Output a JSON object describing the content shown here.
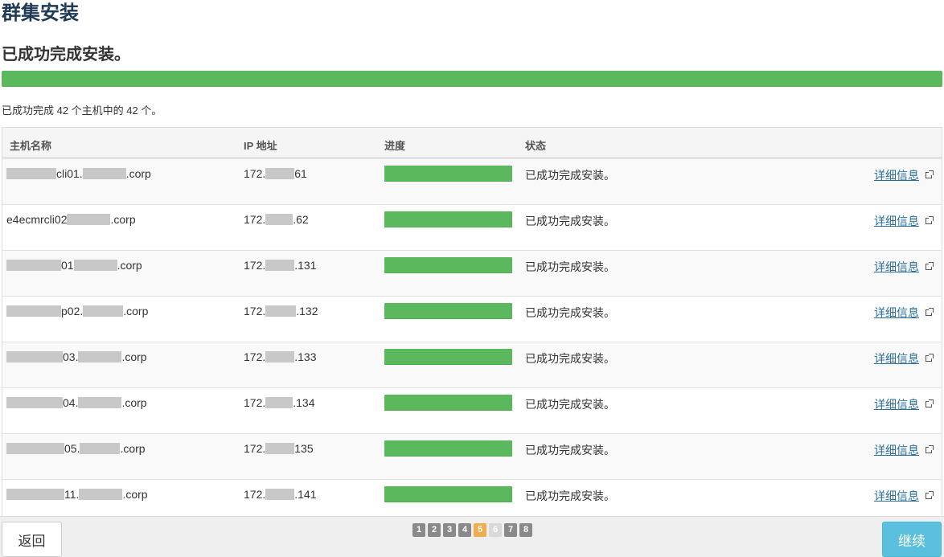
{
  "page": {
    "title": "群集安装"
  },
  "install": {
    "status_heading": "已成功完成安装。",
    "progress_fraction": 1.0,
    "summary": "已成功完成 42 个主机中的 42 个。"
  },
  "table": {
    "headers": {
      "host": "主机名称",
      "ip": "IP 地址",
      "progress": "进度",
      "status": "状态"
    },
    "rows": [
      {
        "host_a": "",
        "host_b": "cli01.",
        "host_c": ".corp",
        "ip_a": "172.",
        "ip_b": "61",
        "progress": 1.0,
        "status": "已成功完成安装。",
        "detail": "详细信息"
      },
      {
        "host_a": "",
        "host_b": "e4ecmrcli02",
        "host_c": ".corp",
        "ip_a": "172.",
        "ip_b": ".62",
        "progress": 1.0,
        "status": "已成功完成安装。",
        "detail": "详细信息"
      },
      {
        "host_a": "",
        "host_b": "01",
        "host_c": ".corp",
        "ip_a": "172.",
        "ip_b": ".131",
        "progress": 1.0,
        "status": "已成功完成安装。",
        "detail": "详细信息"
      },
      {
        "host_a": "",
        "host_b": "p02.",
        "host_c": ".corp",
        "ip_a": "172.",
        "ip_b": ".132",
        "progress": 1.0,
        "status": "已成功完成安装。",
        "detail": "详细信息"
      },
      {
        "host_a": "",
        "host_b": "03.",
        "host_c": ".corp",
        "ip_a": "172.",
        "ip_b": ".133",
        "progress": 1.0,
        "status": "已成功完成安装。",
        "detail": "详细信息"
      },
      {
        "host_a": "",
        "host_b": "04.",
        "host_c": ".corp",
        "ip_a": "172.",
        "ip_b": ".134",
        "progress": 1.0,
        "status": "已成功完成安装。",
        "detail": "详细信息"
      },
      {
        "host_a": "",
        "host_b": "05.",
        "host_c": ".corp",
        "ip_a": "172.",
        "ip_b": "135",
        "progress": 1.0,
        "status": "已成功完成安装。",
        "detail": "详细信息"
      },
      {
        "host_a": "",
        "host_b": "11.",
        "host_c": ".corp",
        "ip_a": "172.",
        "ip_b": ".141",
        "progress": 1.0,
        "status": "已成功完成安装。",
        "detail": "详细信息"
      }
    ]
  },
  "pager": {
    "pages": [
      "1",
      "2",
      "3",
      "4",
      "5",
      "6",
      "7",
      "8"
    ],
    "current": "5",
    "disabled": [
      "6"
    ]
  },
  "footer": {
    "back_label": "返回",
    "continue_label": "继续"
  },
  "colors": {
    "success": "#5cb85c",
    "link": "#2a6e9e",
    "continue": "#5bc0de",
    "current_page": "#f0ad4e"
  }
}
